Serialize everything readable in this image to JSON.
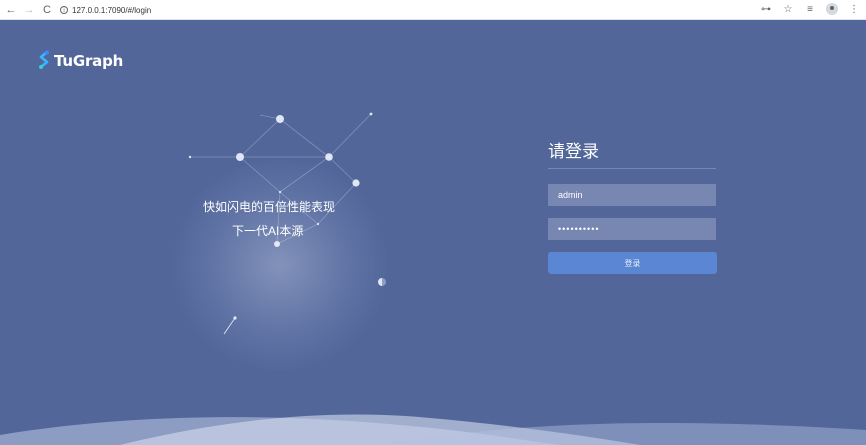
{
  "browser": {
    "url": "127.0.0.1:7090/#/login"
  },
  "brand": {
    "name": "TuGraph"
  },
  "hero": {
    "line1": "快如闪电的百倍性能表现",
    "line2": "下一代AI本源"
  },
  "login": {
    "title": "请登录",
    "username_value": "admin",
    "password_value": "••••••••••",
    "submit_label": "登录"
  },
  "colors": {
    "background": "#52669a",
    "button": "#5b86d4",
    "field": "#7787b1"
  }
}
